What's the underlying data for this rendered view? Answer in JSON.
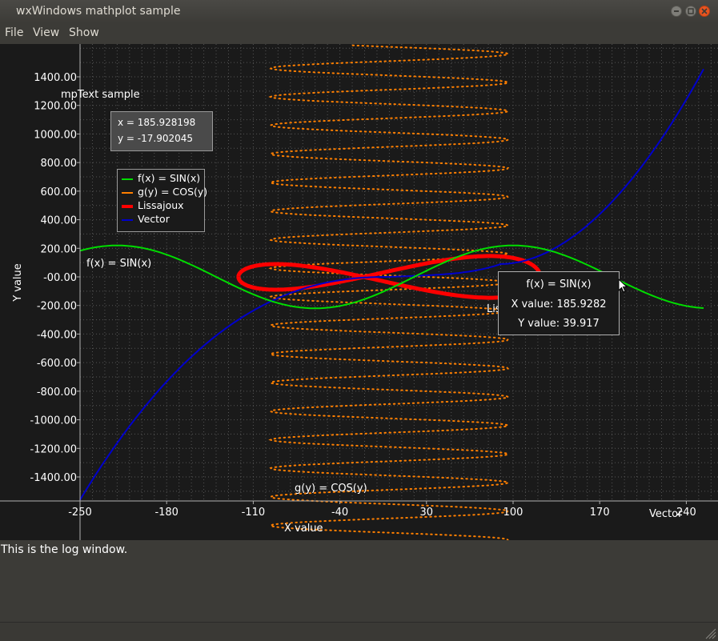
{
  "window": {
    "title": "wxWindows mathplot sample"
  },
  "menu": {
    "file": "File",
    "view": "View",
    "show": "Show"
  },
  "plot": {
    "mptext": "mpText sample",
    "coords": {
      "x": "x = 185.928198",
      "y": "y = -17.902045"
    },
    "legend": [
      {
        "label": "f(x) = SIN(x)",
        "color": "#00dd00"
      },
      {
        "label": "g(y) = COS(y)",
        "color": "#ff7f00"
      },
      {
        "label": "Lissajoux",
        "color": "#ff0000"
      },
      {
        "label": "Vector",
        "color": "#0000cc"
      }
    ],
    "series_labels": {
      "sin": "f(x) = SIN(x)",
      "cos": "g(y) = COS(y)",
      "lissa_partial": "Lis",
      "vector": "Vector"
    },
    "tooltip": {
      "title": "f(x) = SIN(x)",
      "xval": "X value: 185.9282",
      "yval": "Y value: 39.917"
    },
    "axis_colors": {
      "background": "#1a1a1a",
      "grid": "#555555",
      "axis": "#b0b0b0"
    }
  },
  "chart_data": {
    "type": "line",
    "xlabel": "X value",
    "ylabel": "Y value",
    "xlim": [
      -250,
      265
    ],
    "ylim": [
      -1580,
      1620
    ],
    "x_ticks": [
      -250,
      -180,
      -110,
      -40,
      30,
      100,
      170,
      240
    ],
    "x_tick_labels": [
      "-250",
      "-180",
      "-110",
      "-40",
      "30",
      "100",
      "170",
      "240"
    ],
    "y_ticks": [
      1400,
      1200,
      1000,
      800,
      600,
      400,
      200,
      0,
      -200,
      -400,
      -600,
      -800,
      -1000,
      -1200,
      -1400
    ],
    "y_tick_labels": [
      "1400.00",
      "1200.00",
      "1000.00",
      "800.00",
      "600.00",
      "400.00",
      "200.00",
      "-00.00",
      "-200.00",
      "-400.00",
      "-600.00",
      "-800.00",
      "-1000.00",
      "-1200.00",
      "-1400.00"
    ],
    "grid": true,
    "series": [
      {
        "name": "f(x) = SIN(x)",
        "color": "#00dd00",
        "amplitude": 220,
        "period_x": 320,
        "peak_x": 100,
        "x_range": [
          -250,
          255
        ]
      },
      {
        "name": "g(y) = COS(y)",
        "color": "#ff7f00",
        "x_center": 0,
        "x_amplitude": 96,
        "y_period": 200,
        "y_range": [
          -1900,
          1620
        ]
      },
      {
        "name": "Lissajoux",
        "color": "#ff0000",
        "x_center": 0,
        "x_amplitude": 122,
        "y_center": 0,
        "y_amplitude": 130
      },
      {
        "name": "Vector",
        "color": "#0000cc",
        "x": [
          -250,
          -200,
          -150,
          -100,
          -50,
          0,
          50,
          100,
          150,
          200,
          255
        ],
        "y": [
          -1560,
          -1000,
          -600,
          -250,
          -60,
          0,
          20,
          120,
          380,
          780,
          1470
        ]
      }
    ]
  }
}
